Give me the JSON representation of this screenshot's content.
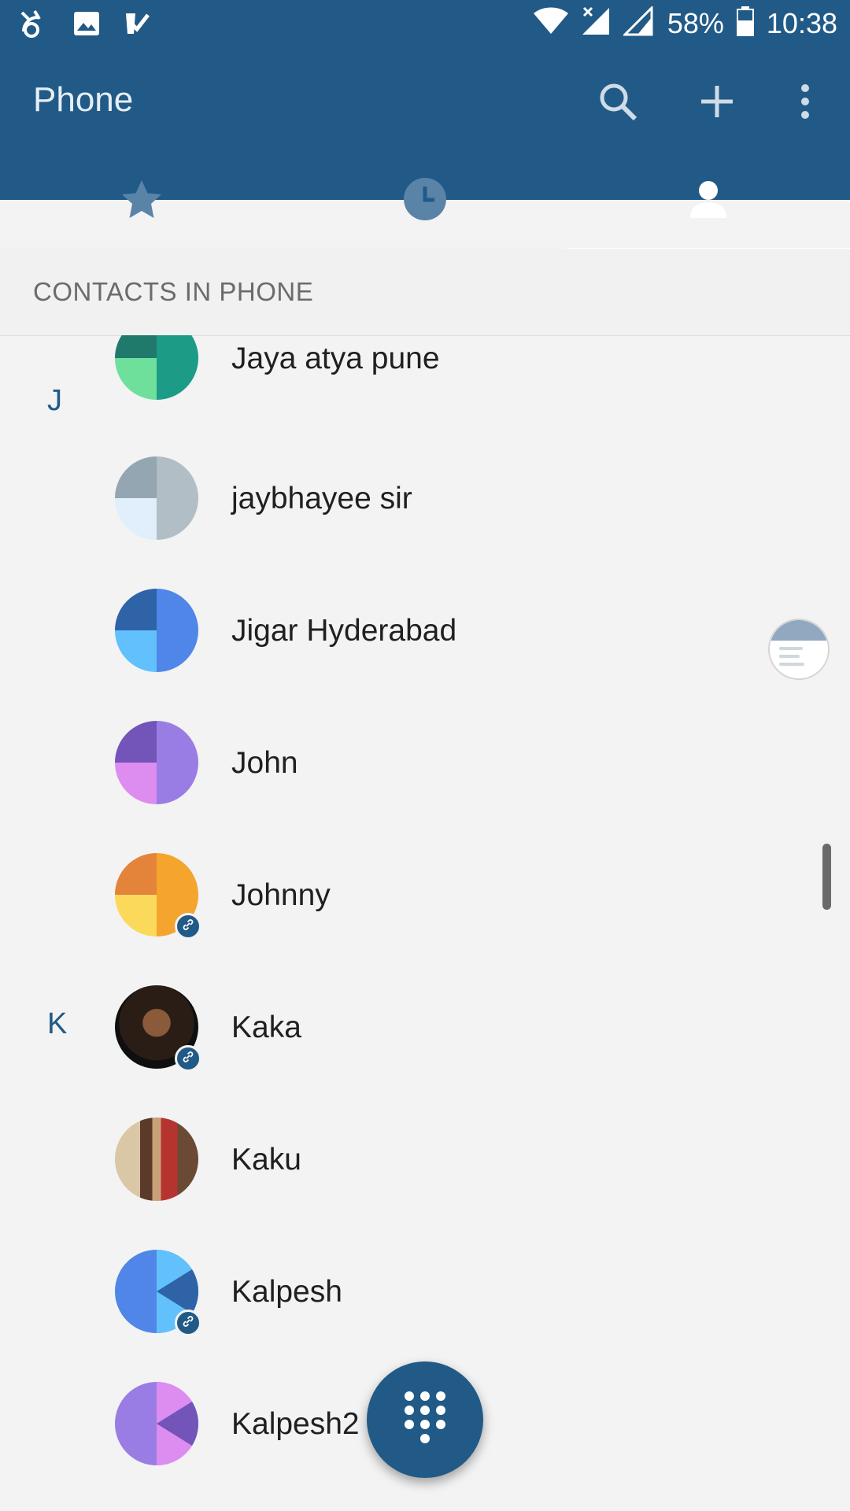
{
  "status_bar": {
    "battery": "58%",
    "time": "10:38"
  },
  "app_bar": {
    "title": "Phone",
    "actions": [
      "search-icon",
      "add-icon",
      "more-vert-icon"
    ]
  },
  "tabs": [
    {
      "icon": "star-icon",
      "active": false
    },
    {
      "icon": "clock-icon",
      "active": false
    },
    {
      "icon": "person-icon",
      "active": true
    }
  ],
  "section": {
    "header": "CONTACTS IN PHONE"
  },
  "contacts": [
    {
      "letter": "",
      "name": "Jaya atya pune"
    },
    {
      "letter": "J",
      "name": ""
    },
    {
      "letter": "",
      "name": "jaybhayee sir"
    },
    {
      "letter": "",
      "name": "Jigar Hyderabad"
    },
    {
      "letter": "",
      "name": "John"
    },
    {
      "letter": "",
      "name": "Johnny"
    },
    {
      "letter": "K",
      "name": "Kaka"
    },
    {
      "letter": "",
      "name": "Kaku"
    },
    {
      "letter": "",
      "name": "Kalpesh"
    },
    {
      "letter": "",
      "name": "Kalpesh2"
    }
  ],
  "colors": {
    "primary": "#215a86",
    "background": "#f3f3f3"
  }
}
